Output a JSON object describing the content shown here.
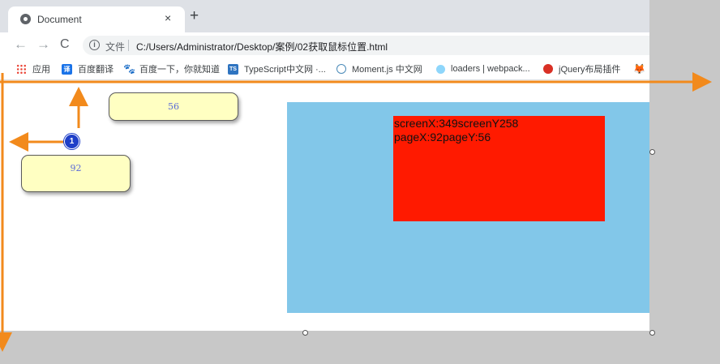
{
  "tab": {
    "title": "Document",
    "close_glyph": "×",
    "new_tab_glyph": "+"
  },
  "nav": {
    "back_glyph": "←",
    "forward_glyph": "→",
    "reload_glyph": "C"
  },
  "address": {
    "info_glyph": "i",
    "scheme_label": "文件",
    "url": "C:/Users/Administrator/Desktop/案例/02获取鼠标位置.html"
  },
  "bookmarks": [
    {
      "label": "应用",
      "icon": "apps-grid-icon"
    },
    {
      "label": "百度翻译",
      "icon": "baidu-translate-icon",
      "glyph": "译"
    },
    {
      "label": "百度一下，你就知道",
      "icon": "baidu-paw-icon",
      "glyph": "🐾"
    },
    {
      "label": "TypeScript中文网 ·...",
      "icon": "typescript-icon",
      "glyph": "TS"
    },
    {
      "label": "Moment.js 中文网",
      "icon": "moment-clock-icon"
    },
    {
      "label": "loaders | webpack...",
      "icon": "webpack-icon"
    },
    {
      "label": "jQuery布局插件",
      "icon": "jquery-icon"
    },
    {
      "label": "",
      "icon": "gitlab-fox-icon",
      "glyph": "🦊"
    }
  ],
  "content": {
    "line1": "screenX:349screenY258",
    "line2": "pageX:92pageY:56"
  },
  "annotations": {
    "callout_top": "56",
    "callout_left": "92",
    "marker_number": "1",
    "arrow_color": "#f28a1c",
    "callout_fill": "#ffffc2"
  },
  "colors": {
    "outer_box": "#82c7e9",
    "inner_box": "#ff1a00"
  }
}
